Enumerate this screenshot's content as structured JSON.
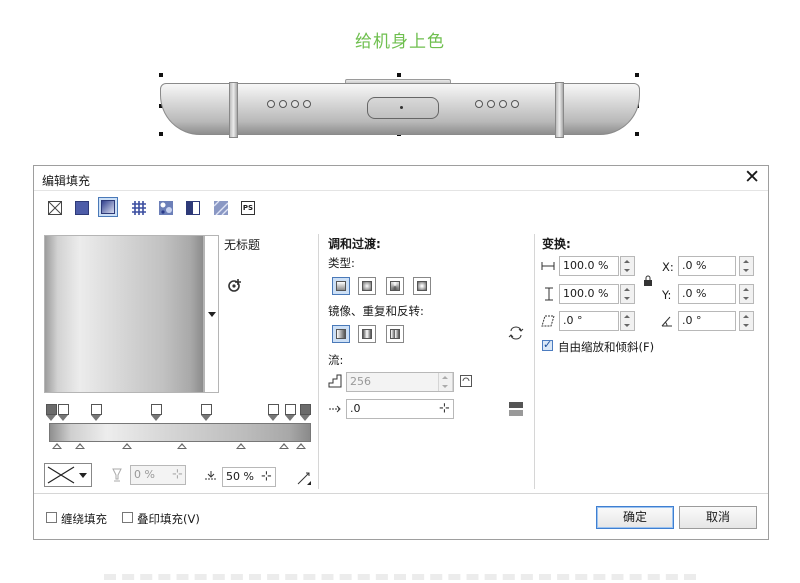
{
  "heading": "给机身上色",
  "dialog": {
    "title": "编辑填充",
    "close": "✕",
    "fill_types": [
      "no-fill",
      "uniform-fill",
      "fountain-fill",
      "vector-pattern",
      "bitmap-pattern",
      "two-color-pattern",
      "texture-fill",
      "postscript-fill"
    ],
    "ps_label": "PS",
    "preset_name": "无标题",
    "blend": {
      "title": "调和过渡:",
      "type_label": "类型:",
      "mirror_label": "镜像、重复和反转:",
      "flow_label": "流:",
      "steps_value": "256",
      "accel_value": ".0"
    },
    "transform": {
      "title": "变换:",
      "width_value": "100.0 %",
      "height_value": "100.0 %",
      "x_label": "X:",
      "x_value": ".0 %",
      "y_label": "Y:",
      "y_value": ".0 %",
      "skew_value": ".0 °",
      "rotate_value": ".0 °",
      "free_scale_label": "自由缩放和倾斜(F)",
      "free_scale_checked": true
    },
    "node": {
      "opacity_value": "0 %",
      "position_value": "50 %"
    },
    "footer": {
      "wrap_fill_label": "缠绕填充",
      "overprint_label": "叠印填充(V)",
      "ok_label": "确定",
      "cancel_label": "取消"
    }
  }
}
